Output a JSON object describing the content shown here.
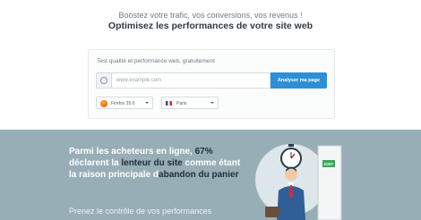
{
  "hero": {
    "tagline": "Boostez votre trafic, vos conversions, vos revenus !",
    "headline": "Optimisez les performances de votre site web"
  },
  "test_card": {
    "label": "Test qualité et performance web, gratuitement",
    "url_placeholder": "www.example.com",
    "analyze_button": "Analyser ma page",
    "browser_select": "Firefox 35.0",
    "location_select": "Paris"
  },
  "promo": {
    "stat_part1": "Parmi les acheteurs en ligne, ",
    "stat_pct": "67%",
    "stat_part2": " déclarent la ",
    "stat_hl1": "lenteur du site",
    "stat_part3": " comme étant la raison principale d",
    "stat_hl2": "abandon du panier",
    "subtext": "Prenez le contrôle de vos performances",
    "exit_sign": "EXIT"
  },
  "colors": {
    "accent": "#2f8fd6",
    "band": "#97aeb6",
    "heading": "#2b3a46"
  },
  "icons": {
    "refresh": "refresh-icon",
    "browser": "firefox-icon",
    "flag": "france-flag-icon"
  }
}
